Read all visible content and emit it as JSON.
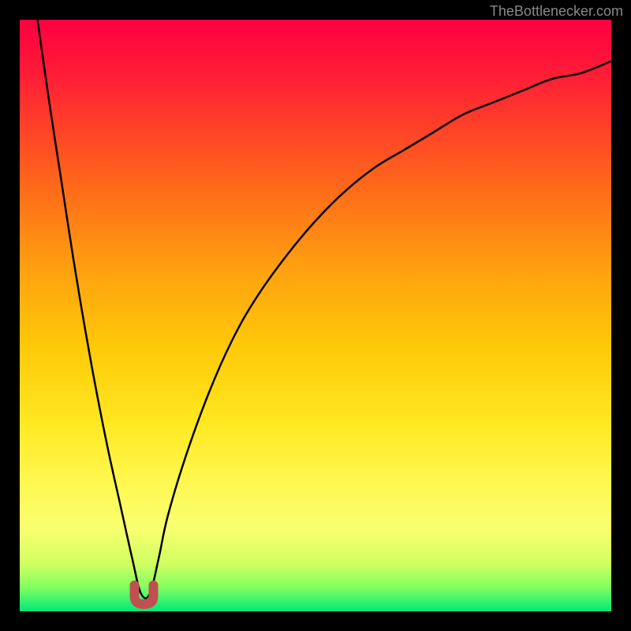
{
  "watermark": "TheBottlenecker.com",
  "chart_data": {
    "type": "line",
    "title": "",
    "xlabel": "",
    "ylabel": "",
    "xlim": [
      0,
      100
    ],
    "ylim": [
      0,
      100
    ],
    "series": [
      {
        "name": "bottleneck-curve",
        "description": "V-shaped bottleneck curve with minimum around x=21",
        "x": [
          3,
          5,
          7,
          9,
          11,
          13,
          15,
          17,
          19,
          20.5,
          22,
          23.5,
          25,
          28,
          32,
          36,
          40,
          45,
          50,
          55,
          60,
          65,
          70,
          75,
          80,
          85,
          90,
          95,
          100
        ],
        "y": [
          100,
          86,
          73,
          60,
          48,
          37,
          27,
          18,
          9,
          3,
          3,
          9,
          16,
          26,
          37,
          46,
          53,
          60,
          66,
          71,
          75,
          78,
          81,
          84,
          86,
          88,
          90,
          91,
          93
        ]
      }
    ],
    "gradient_stops": [
      {
        "offset": 0,
        "color": "#ff0040"
      },
      {
        "offset": 0.08,
        "color": "#ff1838"
      },
      {
        "offset": 0.18,
        "color": "#ff4028"
      },
      {
        "offset": 0.3,
        "color": "#ff7018"
      },
      {
        "offset": 0.42,
        "color": "#ffa010"
      },
      {
        "offset": 0.55,
        "color": "#ffc808"
      },
      {
        "offset": 0.68,
        "color": "#ffe820"
      },
      {
        "offset": 0.78,
        "color": "#fff850"
      },
      {
        "offset": 0.86,
        "color": "#f8ff70"
      },
      {
        "offset": 0.92,
        "color": "#d0ff60"
      },
      {
        "offset": 0.96,
        "color": "#80ff60"
      },
      {
        "offset": 1.0,
        "color": "#00e878"
      }
    ],
    "marker": {
      "x": 21,
      "y": 2,
      "color": "#c05050",
      "shape": "u"
    }
  }
}
